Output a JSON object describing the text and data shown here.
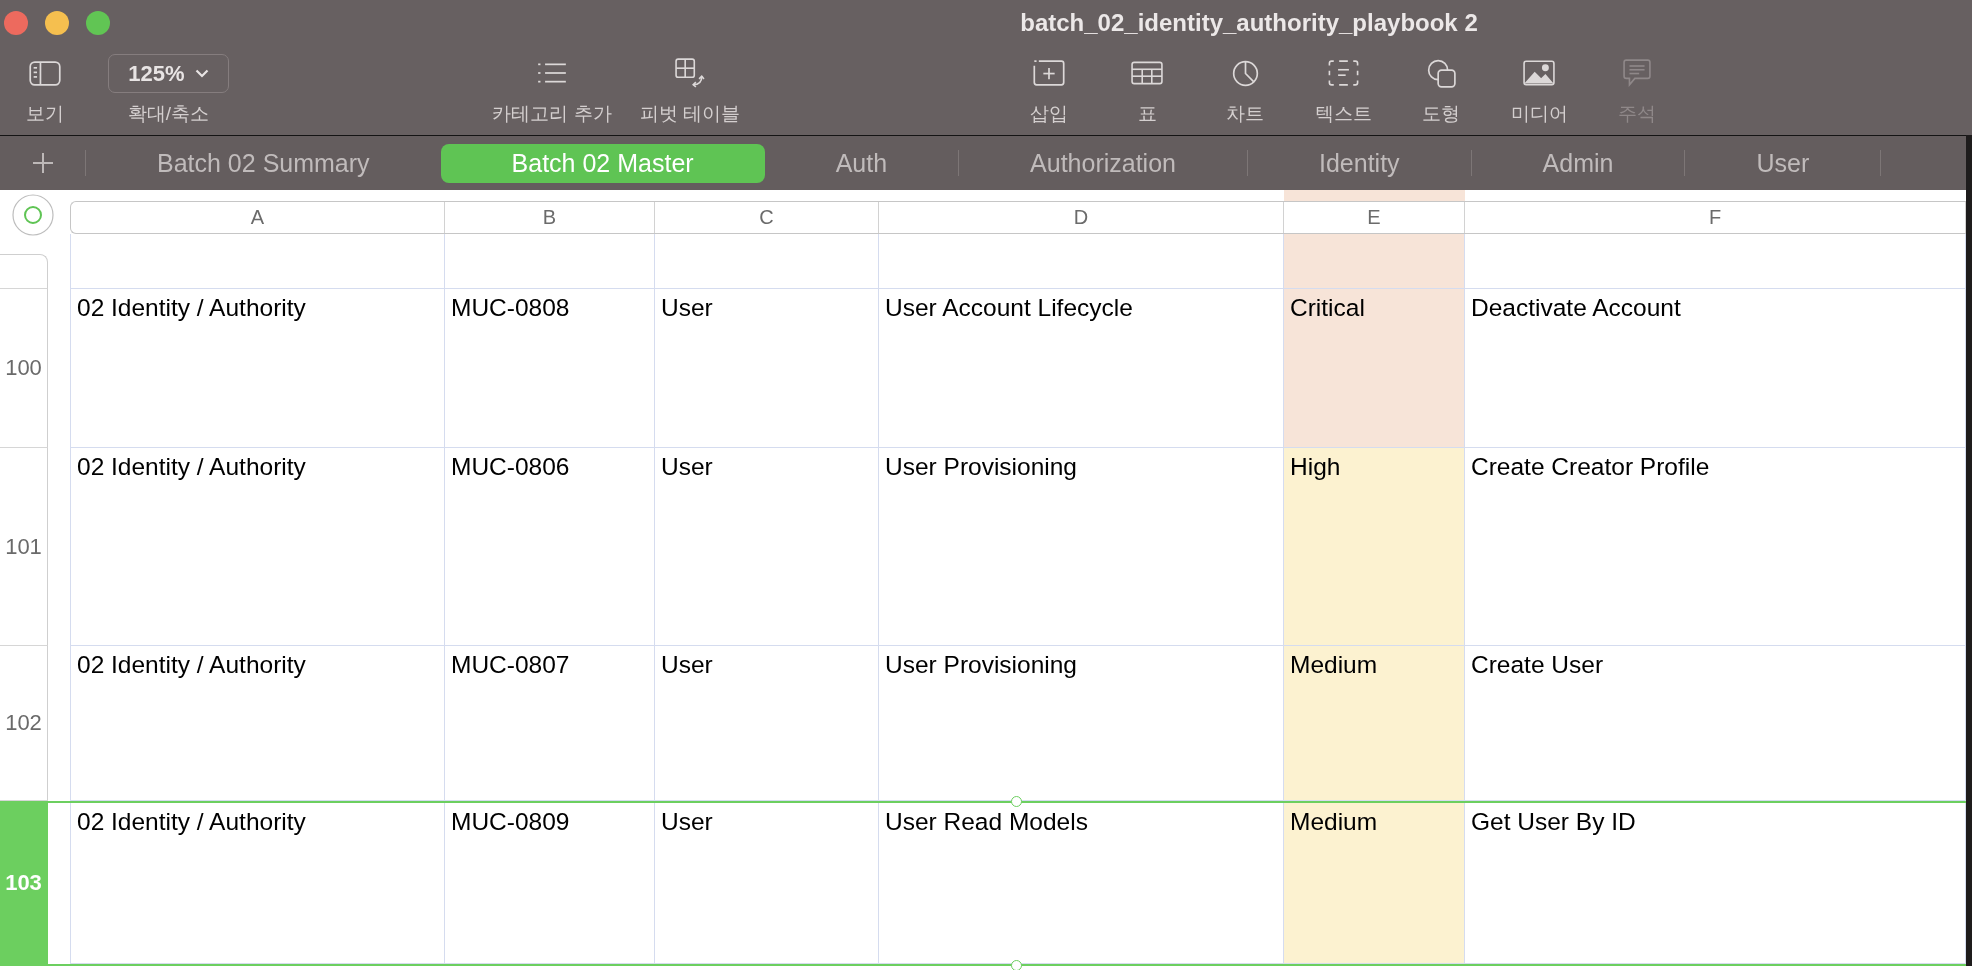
{
  "window": {
    "title": "batch_02_identity_authority_playbook 2"
  },
  "toolbar": {
    "left": [
      {
        "label": "보기",
        "disabled": false
      }
    ],
    "zoom": {
      "value": "125%",
      "label": "확대/축소"
    },
    "middle": [
      {
        "label": "카테고리 추가",
        "disabled": false
      },
      {
        "label": "피벗 테이블",
        "disabled": false
      }
    ],
    "right": [
      {
        "label": "삽입",
        "disabled": false
      },
      {
        "label": "표",
        "disabled": false
      },
      {
        "label": "차트",
        "disabled": false
      },
      {
        "label": "텍스트",
        "disabled": false
      },
      {
        "label": "도형",
        "disabled": false
      },
      {
        "label": "미디어",
        "disabled": false
      },
      {
        "label": "주석",
        "disabled": true
      }
    ]
  },
  "sheet_tabs": [
    {
      "label": "Batch 02 Summary",
      "selected": false
    },
    {
      "label": "Batch 02 Master",
      "selected": true
    },
    {
      "label": "Auth",
      "selected": false
    },
    {
      "label": "Authorization",
      "selected": false
    },
    {
      "label": "Identity",
      "selected": false
    },
    {
      "label": "Admin",
      "selected": false
    },
    {
      "label": "User",
      "selected": false
    }
  ],
  "table": {
    "columns": [
      "A",
      "B",
      "C",
      "D",
      "E",
      "F"
    ],
    "partial_row": {
      "cells": [
        {},
        {},
        {},
        {},
        {
          "color": "#f7e4d8"
        },
        {}
      ]
    },
    "rows": [
      {
        "number": "100",
        "selected": false,
        "cells": [
          {
            "text": "02 Identity / Authority"
          },
          {
            "text": "MUC-0808"
          },
          {
            "text": "User"
          },
          {
            "text": "User Account Lifecycle"
          },
          {
            "text": "Critical",
            "color": "#f7e4d8"
          },
          {
            "text": "Deactivate Account"
          }
        ]
      },
      {
        "number": "101",
        "selected": false,
        "cells": [
          {
            "text": "02 Identity / Authority"
          },
          {
            "text": "MUC-0806"
          },
          {
            "text": "User"
          },
          {
            "text": "User Provisioning"
          },
          {
            "text": "High",
            "color": "#fcf2d0"
          },
          {
            "text": "Create Creator Profile"
          }
        ]
      },
      {
        "number": "102",
        "selected": false,
        "cells": [
          {
            "text": "02 Identity / Authority"
          },
          {
            "text": "MUC-0807"
          },
          {
            "text": "User"
          },
          {
            "text": "User Provisioning"
          },
          {
            "text": "Medium",
            "color": "#fcf2d0"
          },
          {
            "text": "Create User"
          }
        ]
      },
      {
        "number": "103",
        "selected": true,
        "cells": [
          {
            "text": "02 Identity / Authority"
          },
          {
            "text": "MUC-0809"
          },
          {
            "text": "User"
          },
          {
            "text": "User Read Models"
          },
          {
            "text": "Medium",
            "color": "#fcf2d0"
          },
          {
            "text": "Get User By ID"
          }
        ]
      }
    ]
  }
}
